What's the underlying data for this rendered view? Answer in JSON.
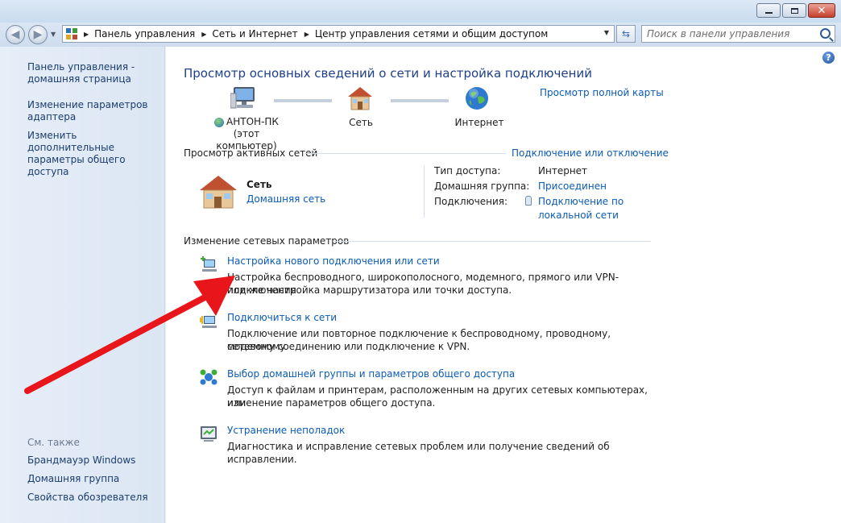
{
  "window": {
    "minimize_label": "_",
    "maximize_label": "□",
    "close_label": "✕"
  },
  "nav": {
    "back_glyph": "◀",
    "forward_glyph": "▶",
    "breadcrumbs": [
      "Панель управления",
      "Сеть и Интернет",
      "Центр управления сетями и общим доступом"
    ],
    "refresh_glyph": "⇆",
    "search_placeholder": "Поиск в панели управления"
  },
  "sidebar": {
    "items": [
      {
        "label": "Панель управления - домашняя страница"
      },
      {
        "label": "Изменение параметров адаптера"
      },
      {
        "label": "Изменить дополнительные параметры общего доступа"
      }
    ],
    "see_also_title": "См. также",
    "see_also": [
      {
        "label": "Брандмауэр Windows"
      },
      {
        "label": "Домашняя группа"
      },
      {
        "label": "Свойства обозревателя"
      }
    ]
  },
  "main": {
    "help_glyph": "?",
    "title": "Просмотр основных сведений о сети и настройка подключений",
    "full_map_link": "Просмотр полной карты",
    "map": {
      "computer_name": "АНТОН-ПК",
      "computer_sub": "(этот компьютер)",
      "network_label": "Сеть",
      "internet_label": "Интернет"
    },
    "active_networks": {
      "title": "Просмотр активных сетей",
      "connect_link": "Подключение или отключение",
      "network_name": "Сеть",
      "network_type_link": "Домашняя сеть",
      "access_type_label": "Тип доступа:",
      "access_type_value": "Интернет",
      "homegroup_label": "Домашняя группа:",
      "homegroup_value": "Присоединен",
      "connections_label": "Подключения:",
      "connections_value_1": "Подключение по",
      "connections_value_2": "локальной сети"
    },
    "change_settings": {
      "title": "Изменение сетевых параметров",
      "tasks": [
        {
          "link": "Настройка нового подключения или сети",
          "desc1": "Настройка беспроводного, широкополосного, модемного, прямого или VPN-подключения",
          "desc2": "или же настройка маршрутизатора или точки доступа."
        },
        {
          "link": "Подключиться к сети",
          "desc1": "Подключение или повторное подключение к беспроводному, проводному, модемному",
          "desc2": "сетевому соединению или подключение к VPN."
        },
        {
          "link": "Выбор домашней группы и параметров общего доступа",
          "desc1": "Доступ к файлам и принтерам, расположенным на других сетевых компьютерах, или",
          "desc2": "изменение параметров общего доступа."
        },
        {
          "link": "Устранение неполадок",
          "desc1": "Диагностика и исправление сетевых проблем или получение сведений об исправлении.",
          "desc2": ""
        }
      ]
    }
  },
  "colors": {
    "link": "#0b5bb5",
    "title": "#1e3f8a",
    "annotation_arrow": "#e8151b"
  }
}
